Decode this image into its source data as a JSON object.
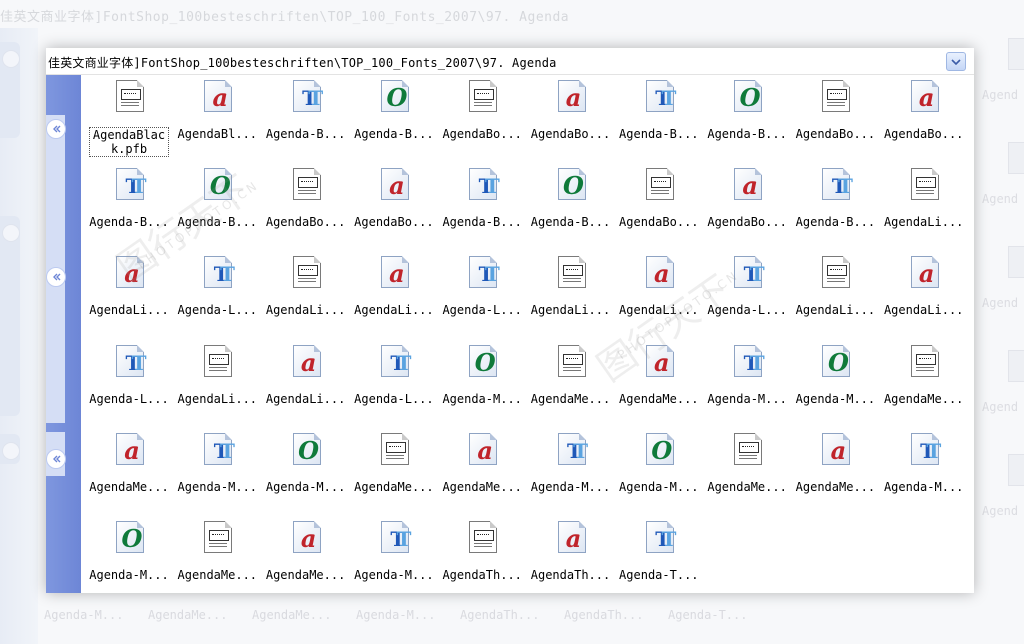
{
  "address_path": "佳英文商业字体]FontShop_100besteschriften\\TOP_100_Fonts_2007\\97. Agenda",
  "background_title": "佳英文商业字体]FontShop_100besteschriften\\TOP_100_Fonts_2007\\97. Agenda",
  "watermark": {
    "mark": "图行天下",
    "site": "PHOTOPHOTO.CN"
  },
  "background_right_labels": [
    "Agend",
    "Agend",
    "Agend",
    "Agend",
    "Agend"
  ],
  "background_bottom_labels": [
    "Agenda-M...",
    "AgendaMe...",
    "AgendaMe...",
    "Agenda-M...",
    "AgendaTh...",
    "AgendaTh...",
    "Agenda-T..."
  ],
  "files": [
    {
      "label": "AgendaBlack.pfb",
      "icon": "type1"
    },
    {
      "label": "AgendaBl...",
      "icon": "a"
    },
    {
      "label": "Agenda-B...",
      "icon": "tt"
    },
    {
      "label": "Agenda-B...",
      "icon": "o"
    },
    {
      "label": "AgendaBo...",
      "icon": "type1"
    },
    {
      "label": "AgendaBo...",
      "icon": "a"
    },
    {
      "label": "Agenda-B...",
      "icon": "tt"
    },
    {
      "label": "Agenda-B...",
      "icon": "o"
    },
    {
      "label": "AgendaBo...",
      "icon": "type1"
    },
    {
      "label": "AgendaBo...",
      "icon": "a"
    },
    {
      "label": "Agenda-B...",
      "icon": "tt"
    },
    {
      "label": "Agenda-B...",
      "icon": "o"
    },
    {
      "label": "AgendaBo...",
      "icon": "type1"
    },
    {
      "label": "AgendaBo...",
      "icon": "a"
    },
    {
      "label": "Agenda-B...",
      "icon": "tt"
    },
    {
      "label": "Agenda-B...",
      "icon": "o"
    },
    {
      "label": "AgendaBo...",
      "icon": "type1"
    },
    {
      "label": "AgendaBo...",
      "icon": "a"
    },
    {
      "label": "Agenda-B...",
      "icon": "tt"
    },
    {
      "label": "AgendaLi...",
      "icon": "type1"
    },
    {
      "label": "AgendaLi...",
      "icon": "a"
    },
    {
      "label": "Agenda-L...",
      "icon": "tt"
    },
    {
      "label": "AgendaLi...",
      "icon": "type1"
    },
    {
      "label": "AgendaLi...",
      "icon": "a"
    },
    {
      "label": "Agenda-L...",
      "icon": "tt"
    },
    {
      "label": "AgendaLi...",
      "icon": "type1"
    },
    {
      "label": "AgendaLi...",
      "icon": "a"
    },
    {
      "label": "Agenda-L...",
      "icon": "tt"
    },
    {
      "label": "AgendaLi...",
      "icon": "type1"
    },
    {
      "label": "AgendaLi...",
      "icon": "a"
    },
    {
      "label": "Agenda-L...",
      "icon": "tt"
    },
    {
      "label": "AgendaLi...",
      "icon": "type1"
    },
    {
      "label": "AgendaLi...",
      "icon": "a"
    },
    {
      "label": "Agenda-L...",
      "icon": "tt"
    },
    {
      "label": "Agenda-M...",
      "icon": "o"
    },
    {
      "label": "AgendaMe...",
      "icon": "type1"
    },
    {
      "label": "AgendaMe...",
      "icon": "a"
    },
    {
      "label": "Agenda-M...",
      "icon": "tt"
    },
    {
      "label": "Agenda-M...",
      "icon": "o"
    },
    {
      "label": "AgendaMe...",
      "icon": "type1"
    },
    {
      "label": "AgendaMe...",
      "icon": "a"
    },
    {
      "label": "Agenda-M...",
      "icon": "tt"
    },
    {
      "label": "Agenda-M...",
      "icon": "o"
    },
    {
      "label": "AgendaMe...",
      "icon": "type1"
    },
    {
      "label": "AgendaMe...",
      "icon": "a"
    },
    {
      "label": "Agenda-M...",
      "icon": "tt"
    },
    {
      "label": "Agenda-M...",
      "icon": "o"
    },
    {
      "label": "AgendaMe...",
      "icon": "type1"
    },
    {
      "label": "AgendaMe...",
      "icon": "a"
    },
    {
      "label": "Agenda-M...",
      "icon": "tt"
    },
    {
      "label": "Agenda-M...",
      "icon": "o"
    },
    {
      "label": "AgendaMe...",
      "icon": "type1"
    },
    {
      "label": "AgendaMe...",
      "icon": "a"
    },
    {
      "label": "Agenda-M...",
      "icon": "tt"
    },
    {
      "label": "AgendaTh...",
      "icon": "type1"
    },
    {
      "label": "AgendaTh...",
      "icon": "a"
    },
    {
      "label": "Agenda-T...",
      "icon": "tt"
    }
  ],
  "selected_index": 0
}
